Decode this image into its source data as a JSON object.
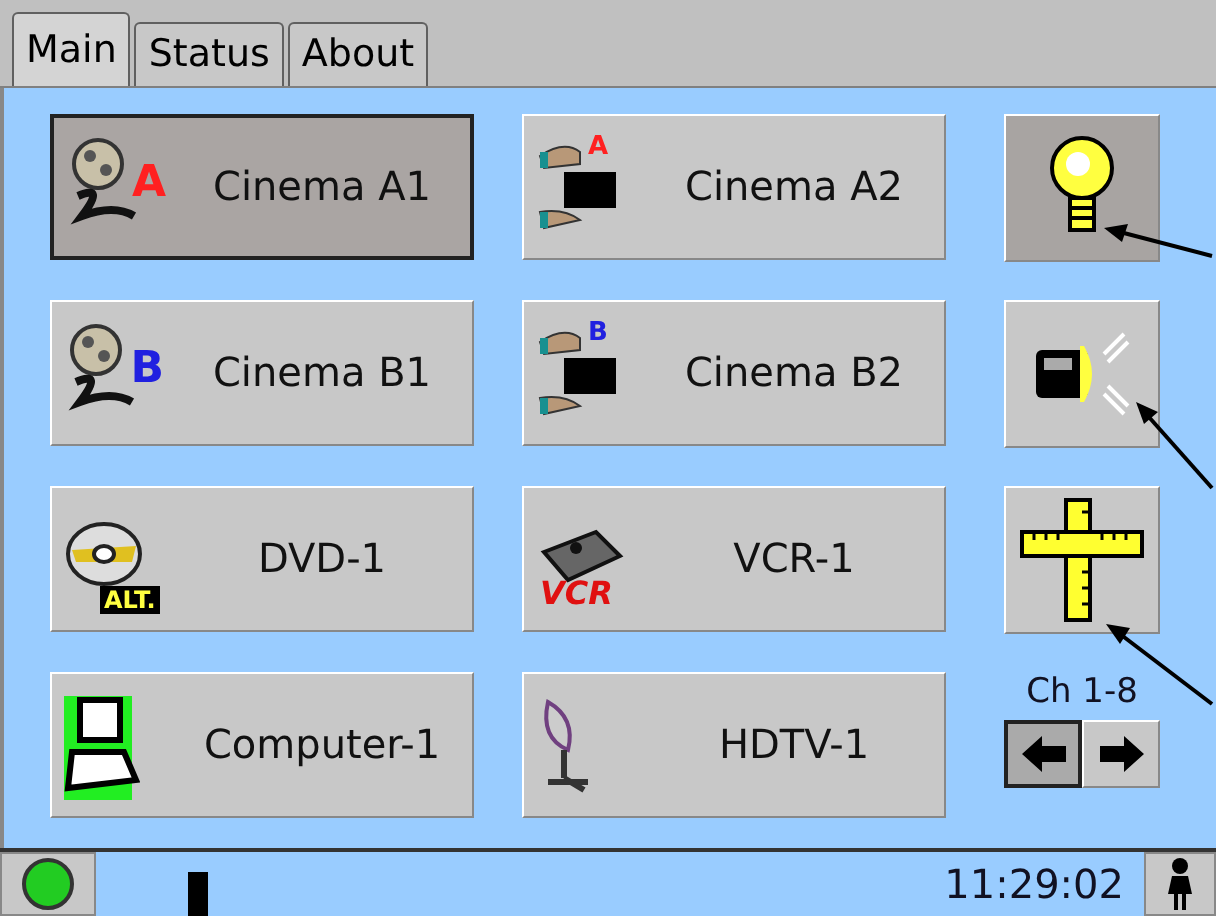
{
  "tabs": [
    {
      "label": "Main",
      "selected": true
    },
    {
      "label": "Status",
      "selected": false
    },
    {
      "label": "About",
      "selected": false
    }
  ],
  "sources": [
    {
      "label": "Cinema A1",
      "kind": "film",
      "badge": "A",
      "color": "#ff2020",
      "selected": true
    },
    {
      "label": "Cinema A2",
      "kind": "clapper",
      "badge": "A",
      "color": "#ff2020",
      "selected": false
    },
    {
      "label": "Cinema B1",
      "kind": "film",
      "badge": "B",
      "color": "#2020e0",
      "selected": false
    },
    {
      "label": "Cinema B2",
      "kind": "clapper",
      "badge": "B",
      "color": "#2020e0",
      "selected": false
    },
    {
      "label": "DVD-1",
      "kind": "disc",
      "badge": "ALT.",
      "color": "#000000",
      "selected": false
    },
    {
      "label": "VCR-1",
      "kind": "vcr",
      "badge": "VCR",
      "color": "#e01010",
      "selected": false
    },
    {
      "label": "Computer-1",
      "kind": "computer",
      "selected": false
    },
    {
      "label": "HDTV-1",
      "kind": "dish",
      "selected": false
    }
  ],
  "controls": [
    {
      "kind": "bulb",
      "selected": true
    },
    {
      "kind": "projector",
      "selected": false
    },
    {
      "kind": "ruler",
      "selected": false
    }
  ],
  "channel": {
    "label": "Ch 1-8",
    "buttons": [
      {
        "kind": "left",
        "selected": true
      },
      {
        "kind": "right",
        "selected": false
      }
    ]
  },
  "status_bar": {
    "time": "11:29:02"
  }
}
